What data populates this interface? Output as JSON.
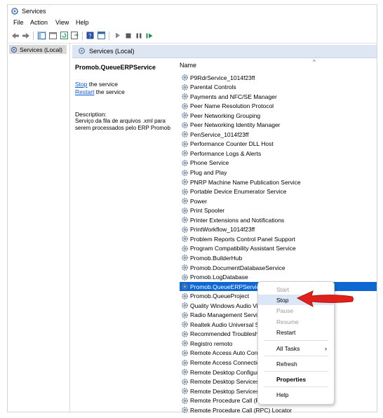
{
  "window": {
    "title": "Services"
  },
  "menu": [
    "File",
    "Action",
    "View",
    "Help"
  ],
  "tree": {
    "root": "Services (Local)"
  },
  "panel": {
    "header": "Services (Local)"
  },
  "description": {
    "service_name": "Promob.QueueERPService",
    "stop_link": "Stop",
    "stop_suffix": " the service",
    "restart_link": "Restart",
    "restart_suffix": " the service",
    "label": "Description:",
    "text": "Serviço da fila de arquivos .xml para serem processados pelo ERP Promob"
  },
  "list": {
    "column_name": "Name",
    "sort_indicator": "^",
    "selected_index": 21,
    "rows": [
      "P9RdrService_1014f23ff",
      "Parental Controls",
      "Payments and NFC/SE Manager",
      "Peer Name Resolution Protocol",
      "Peer Networking Grouping",
      "Peer Networking Identity Manager",
      "PenService_1014f23ff",
      "Performance Counter DLL Host",
      "Performance Logs & Alerts",
      "Phone Service",
      "Plug and Play",
      "PNRP Machine Name Publication Service",
      "Portable Device Enumerator Service",
      "Power",
      "Print Spooler",
      "Printer Extensions and Notifications",
      "PrintWorkflow_1014f23ff",
      "Problem Reports Control Panel Support",
      "Program Compatibility Assistant Service",
      "Promob.BuilderHub",
      "Promob.DocumentDatabaseService",
      "Promob.LogDatabase",
      "Promob.QueueERPService",
      "Promob.QueueProject",
      "Quality Windows Audio Vi",
      "Radio Management Servic",
      "Realtek Audio Universal Se",
      "Recommended Troublesho",
      "Registro remoto",
      "Remote Access Auto Conn",
      "Remote Access Connectio",
      "Remote Desktop Configur",
      "Remote Desktop Services",
      "Remote Desktop Services U",
      "Remote Procedure Call (RI",
      "Remote Procedure Call (RPC) Locator"
    ]
  },
  "context_menu": {
    "start": "Start",
    "stop": "Stop",
    "pause": "Pause",
    "resume": "Resume",
    "restart": "Restart",
    "all_tasks": "All Tasks",
    "refresh": "Refresh",
    "properties": "Properties",
    "help": "Help",
    "submenu_arrow": "›"
  },
  "colors": {
    "selection": "#0f68d1",
    "highlight": "#dbe6f6",
    "annotation_arrow": "#e0201b",
    "link": "#0b57c9"
  }
}
